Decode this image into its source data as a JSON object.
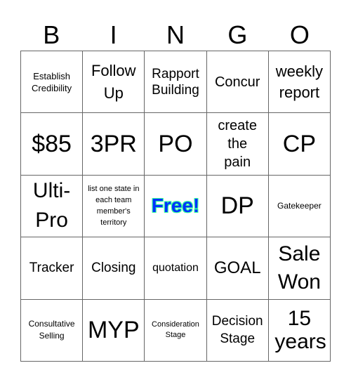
{
  "header": [
    "B",
    "I",
    "N",
    "G",
    "O"
  ],
  "cells": [
    [
      "Establish Credibility",
      "Follow Up",
      "Rapport Building",
      "Concur",
      "weekly report"
    ],
    [
      "$85",
      "3PR",
      "PO",
      "create the pain",
      "CP"
    ],
    [
      "Ulti-Pro",
      "list one state in each team member's territory",
      "Free!",
      "DP",
      "Gatekeeper"
    ],
    [
      "Tracker",
      "Closing",
      "quotation",
      "GOAL",
      "Sale Won"
    ],
    [
      "Consultative Selling",
      "MYP",
      "Consideration Stage",
      "Decision Stage",
      "15 years"
    ]
  ],
  "free_space": {
    "row": 2,
    "col": 2,
    "text_color": "#0033ff",
    "outline_color": "#33ff99"
  }
}
